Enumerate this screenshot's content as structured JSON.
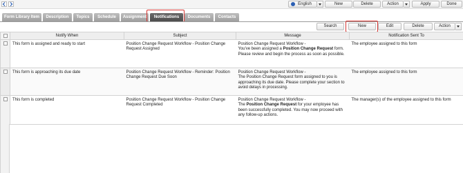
{
  "toolbar": {
    "language": "English",
    "new": "New",
    "delete": "Delete",
    "action": "Action",
    "apply": "Apply",
    "done": "Done"
  },
  "tabs": [
    {
      "label": "Form Library Item"
    },
    {
      "label": "Description"
    },
    {
      "label": "Topics"
    },
    {
      "label": "Schedule"
    },
    {
      "label": "Assignment"
    },
    {
      "label": "Notifications",
      "active": true
    },
    {
      "label": "Documents"
    },
    {
      "label": "Contacts"
    }
  ],
  "grid_toolbar": {
    "search": "Search",
    "new": "New",
    "edit": "Edit",
    "delete": "Delete",
    "action": "Action"
  },
  "table": {
    "headers": [
      "Notify When",
      "Subject",
      "Message",
      "Notification Sent To"
    ],
    "rows": [
      {
        "notify_when": "This form is assigned and ready to start",
        "subject": "Position Change Request Workflow - Position Change Request Assigned",
        "message_lead": "Position Change Request Workflow -",
        "message_a": "You've been assigned a ",
        "message_bold": "Position Change Request",
        "message_b": " form. Please review and begin the process as soon as possible.",
        "sent_to": "The employee assigned to this form"
      },
      {
        "notify_when": "This form is approaching its due date",
        "subject": "Position Change Request Workflow - Reminder: Position Change Request Due Soon",
        "message_lead": "Position Change Request Workflow -",
        "message_a": "The Position Change Request form assigned to you is approaching its due date. Please complete your section to avoid delays in processing.",
        "sent_to": "The employee assigned to this form"
      },
      {
        "notify_when": "This form is completed",
        "subject": "Position Change Request Workflow - Position Change Request Completed",
        "message_lead": "Position Change Request Workflow -",
        "message_a": "The ",
        "message_bold": "Position Change Request",
        "message_b": " for your employee has been successfully completed. You may now proceed with any follow-up actions.",
        "sent_to": "The manager(s) of the employee assigned to this form"
      }
    ]
  },
  "colors": {
    "highlight": "#d6332f",
    "active_tab": "#555555",
    "inactive_tab": "#aaaaaa"
  }
}
